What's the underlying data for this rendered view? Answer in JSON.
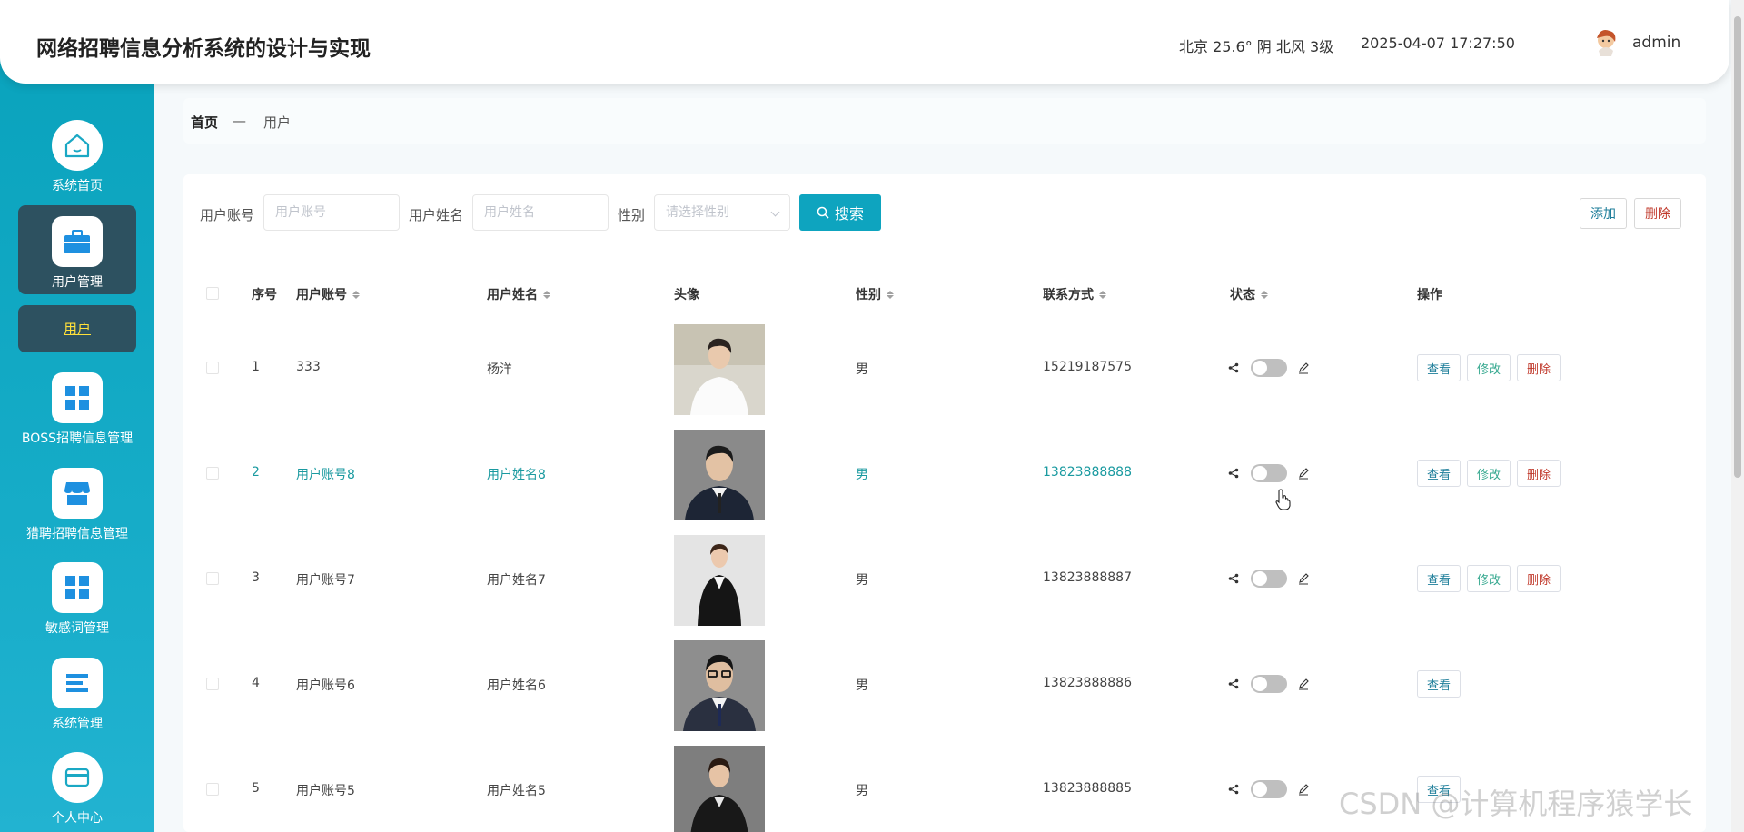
{
  "header": {
    "title": "网络招聘信息分析系统的设计与实现",
    "weather": "北京  25.6°  阴  北风  3级",
    "datetime": "2025-04-07 17:27:50",
    "username": "admin"
  },
  "sidebar": {
    "items": [
      {
        "label": "系统首页",
        "icon": "home-icon"
      },
      {
        "label": "用户管理",
        "icon": "briefcase-icon"
      },
      {
        "label": "BOSS招聘信息管理",
        "icon": "grid-icon"
      },
      {
        "label": "猎聘招聘信息管理",
        "icon": "shop-icon"
      },
      {
        "label": "敏感词管理",
        "icon": "grid-icon"
      },
      {
        "label": "系统管理",
        "icon": "list-icon"
      },
      {
        "label": "个人中心",
        "icon": "card-icon"
      }
    ],
    "sub_item": "用户"
  },
  "breadcrumb": {
    "home": "首页",
    "separator": "—",
    "current": "用户"
  },
  "search": {
    "account_label": "用户账号",
    "account_placeholder": "用户账号",
    "name_label": "用户姓名",
    "name_placeholder": "用户姓名",
    "gender_label": "性别",
    "gender_placeholder": "请选择性别",
    "search_button": "搜索",
    "add_button": "添加",
    "delete_button": "删除"
  },
  "table": {
    "headers": {
      "index": "序号",
      "account": "用户账号",
      "name": "用户姓名",
      "avatar": "头像",
      "gender": "性别",
      "phone": "联系方式",
      "status": "状态",
      "actions": "操作"
    },
    "rows": [
      {
        "index": "1",
        "account": "333",
        "name": "杨洋",
        "gender": "男",
        "phone": "15219187575"
      },
      {
        "index": "2",
        "account": "用户账号8",
        "name": "用户姓名8",
        "gender": "男",
        "phone": "13823888888"
      },
      {
        "index": "3",
        "account": "用户账号7",
        "name": "用户姓名7",
        "gender": "男",
        "phone": "13823888887"
      },
      {
        "index": "4",
        "account": "用户账号6",
        "name": "用户姓名6",
        "gender": "男",
        "phone": "13823888886"
      },
      {
        "index": "5",
        "account": "用户账号5",
        "name": "用户姓名5",
        "gender": "男",
        "phone": "13823888885"
      }
    ],
    "actions": {
      "view": "查看",
      "edit": "修改",
      "delete": "删除"
    }
  },
  "watermark": "CSDN @计算机程序猿学长",
  "colors": {
    "accent": "#0ea4bf",
    "sidebar_active": "#2d5160",
    "sub_item_text": "#ffe03a",
    "highlight_row_text": "#1a9aa0",
    "delete_text": "#c0392b"
  }
}
